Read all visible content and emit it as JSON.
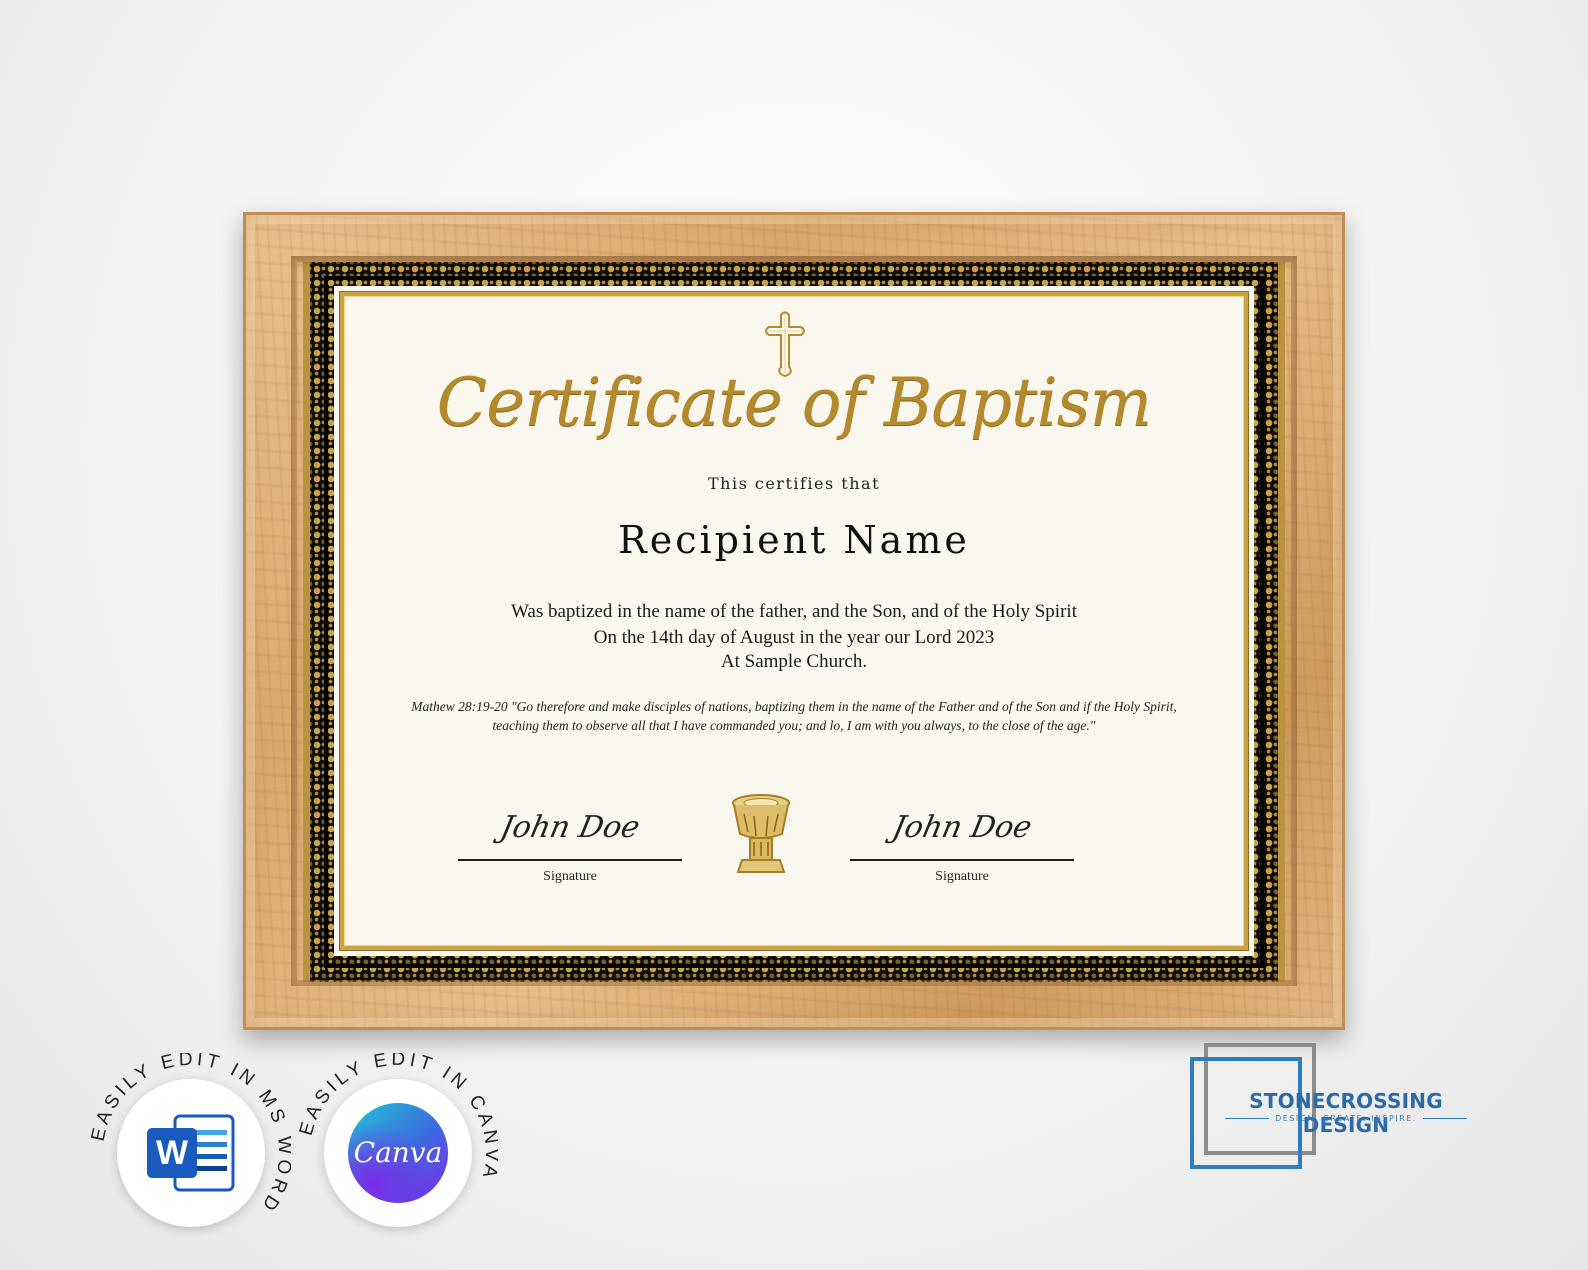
{
  "certificate": {
    "title": "Certificate of Baptism",
    "certifies": "This certifies that",
    "recipient": "Recipient Name",
    "line1": "Was baptized in the name of the father, and the Son, and of the Holy Spirit",
    "line2": "On the 14th day of August in the year our Lord 2023",
    "line3": "At Sample Church.",
    "verse": "Mathew 28:19-20 \"Go therefore and make disciples of nations, baptizing them in the name of the Father and of the Son and if the Holy Spirit, teaching them to observe all that I have commanded you; and lo, I am with you always, to the close of the age.\"",
    "signatures": [
      {
        "script": "John Doe",
        "label": "Signature"
      },
      {
        "script": "John Doe",
        "label": "Signature"
      }
    ],
    "icons": [
      "cross-icon",
      "baptismal-font-icon"
    ]
  },
  "badges": [
    {
      "text": "EASILY EDIT IN MS WORD",
      "logo": "W",
      "icon": "ms-word-icon"
    },
    {
      "text": "EASILY EDIT IN CANVA",
      "logo": "Canva",
      "icon": "canva-icon"
    }
  ],
  "brand": {
    "name": "STONECROSSING DESIGN",
    "tagline": "DESIGN. CREATE. INSPIRE."
  },
  "colors": {
    "gold": "#b48a2c",
    "frame_wood": "#d9a86e",
    "border_black": "#0c0b08",
    "brand_blue": "#2b6aa6",
    "word_blue": "#185abd"
  }
}
